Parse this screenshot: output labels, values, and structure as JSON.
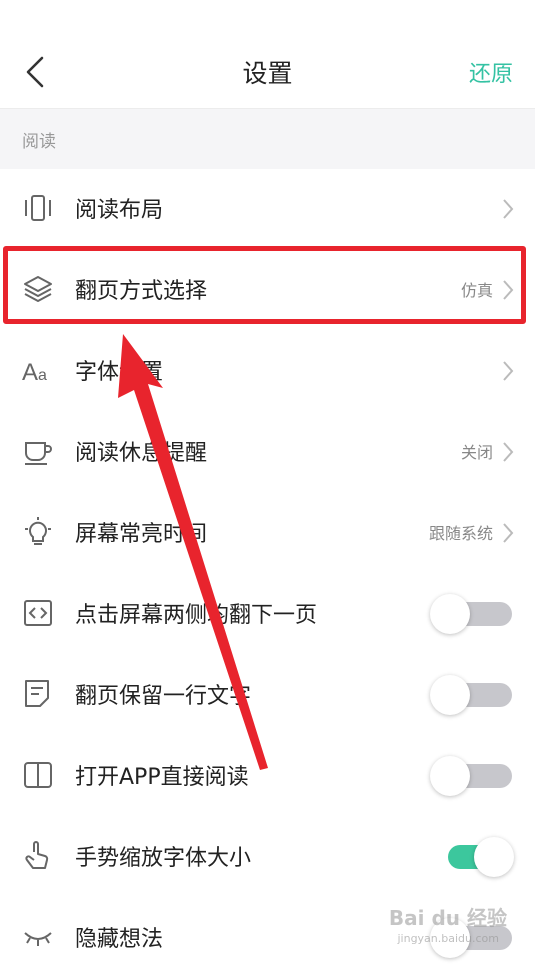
{
  "colors": {
    "accent": "#34c2a3",
    "toggle_on": "#3cc79d",
    "annotation": "#e8242d"
  },
  "header": {
    "title": "设置",
    "restore_label": "还原"
  },
  "section_label": "阅读",
  "rows": [
    {
      "label": "阅读布局",
      "value": "",
      "icon": "layout-icon"
    },
    {
      "label": "翻页方式选择",
      "value": "仿真",
      "icon": "layers-icon"
    },
    {
      "label": "字体设置",
      "value": "",
      "icon": "font-icon"
    },
    {
      "label": "阅读休息提醒",
      "value": "关闭",
      "icon": "cup-icon"
    },
    {
      "label": "屏幕常亮时间",
      "value": "跟随系统",
      "icon": "bulb-icon"
    },
    {
      "label": "点击屏幕两侧均翻下一页",
      "toggle": false,
      "icon": "code-icon"
    },
    {
      "label": "翻页保留一行文字",
      "toggle": false,
      "icon": "note-icon"
    },
    {
      "label": "打开APP直接阅读",
      "toggle": false,
      "icon": "book-icon"
    },
    {
      "label": "手势缩放字体大小",
      "toggle": true,
      "icon": "gesture-icon"
    },
    {
      "label": "隐藏想法",
      "toggle": false,
      "icon": "eye-closed-icon"
    }
  ],
  "watermark": {
    "main": "Bai du 经验",
    "sub": "jingyan.baidu.com"
  }
}
